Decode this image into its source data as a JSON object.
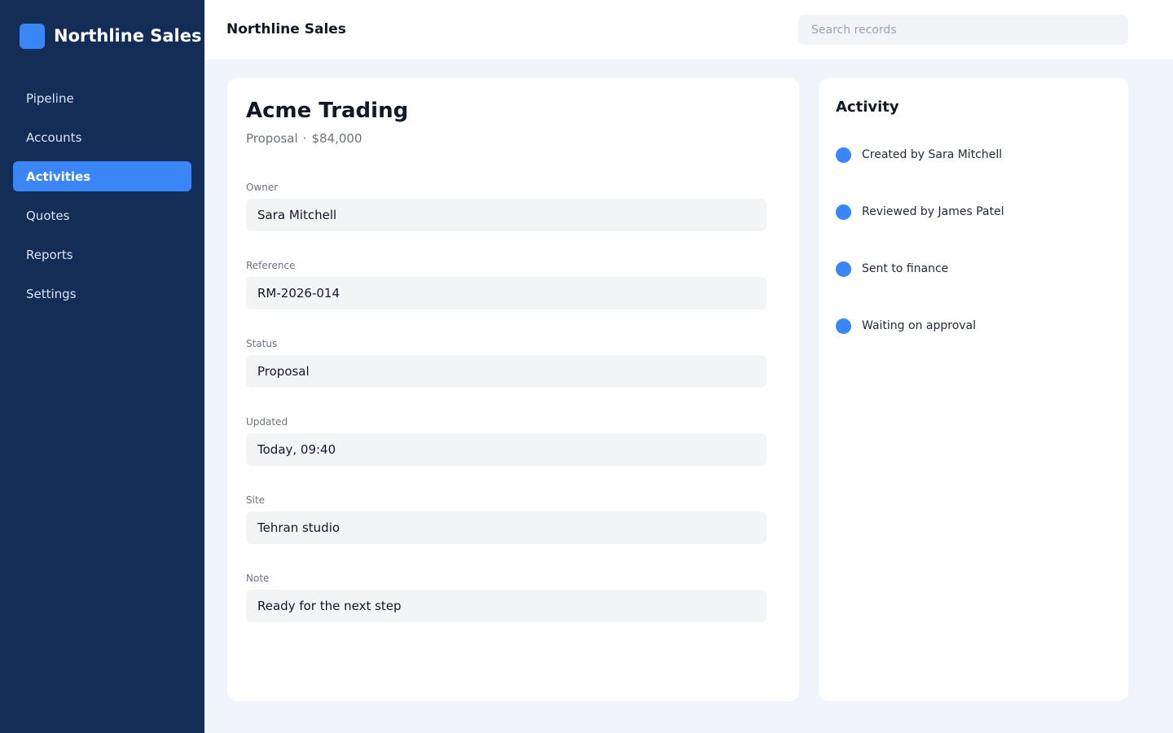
{
  "brand": {
    "name": "Northline Sales"
  },
  "sidebar": {
    "items": [
      {
        "label": "Pipeline",
        "active": false
      },
      {
        "label": "Accounts",
        "active": false
      },
      {
        "label": "Activities",
        "active": true
      },
      {
        "label": "Quotes",
        "active": false
      },
      {
        "label": "Reports",
        "active": false
      },
      {
        "label": "Settings",
        "active": false
      }
    ]
  },
  "header": {
    "title": "Northline Sales",
    "search_placeholder": "Search records"
  },
  "record": {
    "title": "Acme Trading",
    "stage": "Proposal",
    "separator": "·",
    "amount": "$84,000",
    "fields": [
      {
        "label": "Owner",
        "value": "Sara Mitchell"
      },
      {
        "label": "Reference",
        "value": "RM-2026-014"
      },
      {
        "label": "Status",
        "value": "Proposal"
      },
      {
        "label": "Updated",
        "value": "Today, 09:40"
      },
      {
        "label": "Site",
        "value": "Tehran studio"
      },
      {
        "label": "Note",
        "value": "Ready for the next step"
      }
    ]
  },
  "activity": {
    "title": "Activity",
    "items": [
      {
        "text": "Created by Sara Mitchell"
      },
      {
        "text": "Reviewed by James Patel"
      },
      {
        "text": "Sent to finance"
      },
      {
        "text": "Waiting on approval"
      }
    ]
  },
  "colors": {
    "sidebar": "#132d57",
    "accent": "#3b86f7",
    "background": "#f1f5fb"
  }
}
